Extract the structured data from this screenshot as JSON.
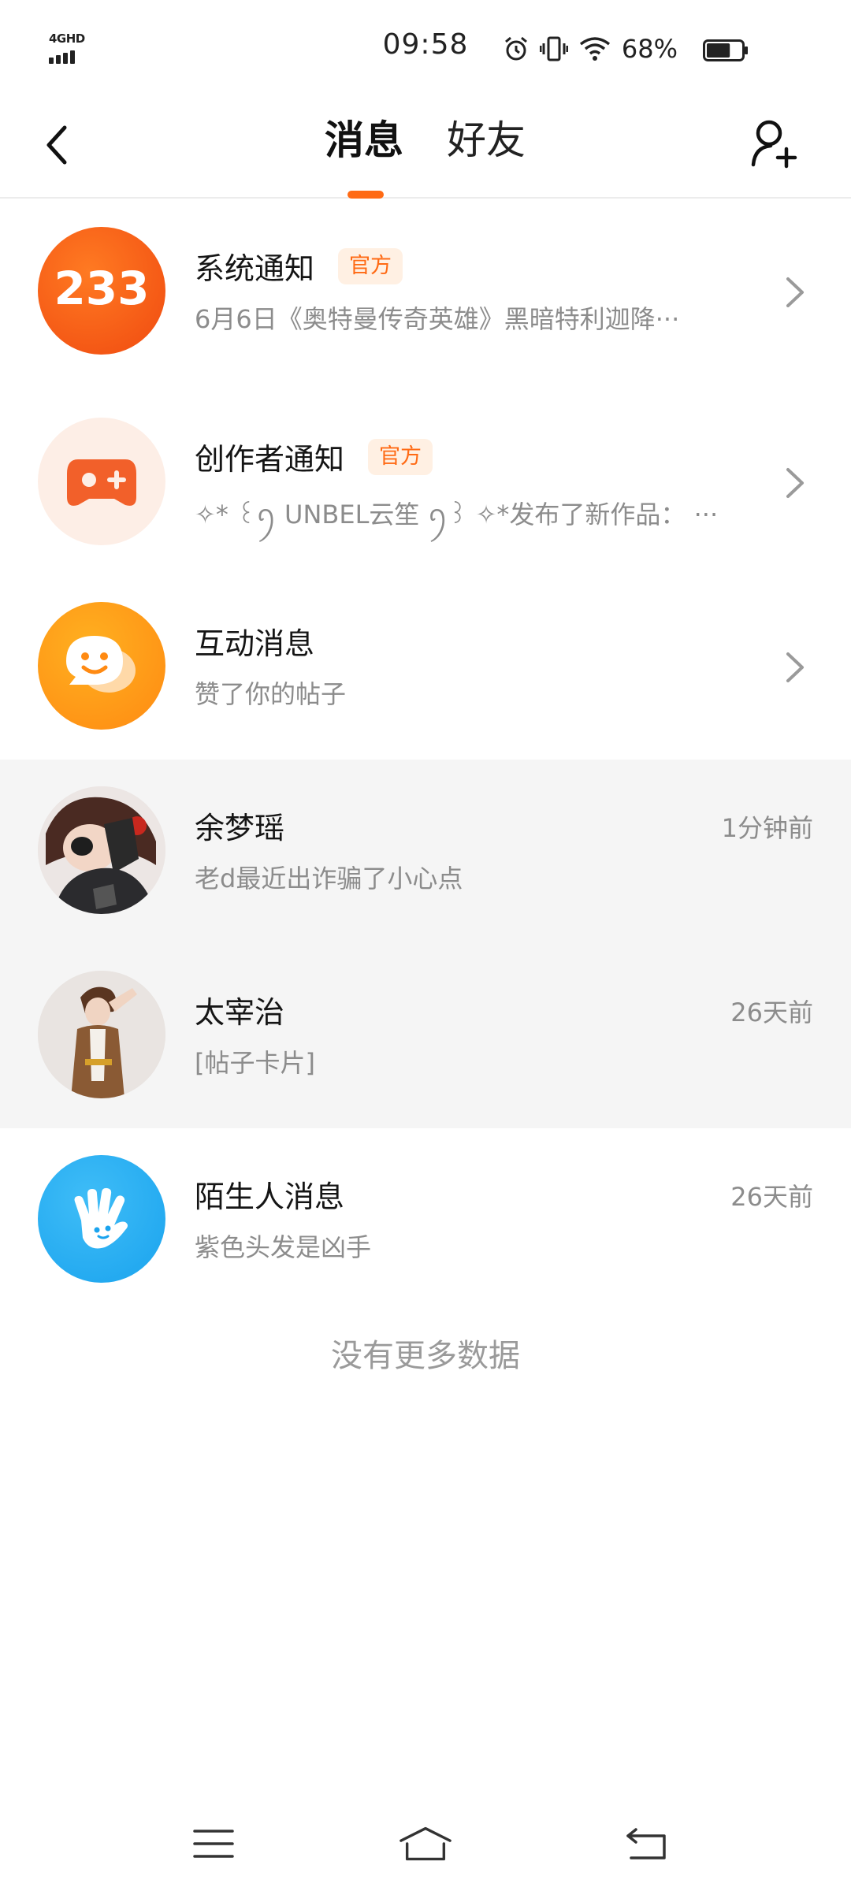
{
  "status_bar": {
    "network": "4GHD",
    "time": "09:58",
    "battery_percent": "68%",
    "battery_level": 0.68,
    "icons": [
      "alarm-icon",
      "vibrate-icon",
      "wifi-icon",
      "battery-icon"
    ]
  },
  "header": {
    "tabs": [
      {
        "label": "消息",
        "active": true
      },
      {
        "label": "好友",
        "active": false
      }
    ],
    "accent_color": "#ff6a14",
    "icons": [
      "back-arrow-icon",
      "add-friend-icon"
    ]
  },
  "conversations": [
    {
      "name": "系统通知",
      "badge": "官方",
      "preview": "6月6日《奥特曼传奇英雄》黑暗特利迦降···",
      "avatar_text": "233",
      "avatar_icon": "app-logo-233",
      "trailing": "chevron"
    },
    {
      "name": "创作者通知",
      "badge": "官方",
      "preview": "✧* ꒰ꪆ UNBEL云笙 ꪆ꒱ ✧*发布了新作品：   ···",
      "avatar_icon": "gamepad-icon",
      "trailing": "chevron"
    },
    {
      "name": "互动消息",
      "preview": "赞了你的帖子",
      "avatar_icon": "chat-bubble-smile-icon",
      "trailing": "chevron"
    },
    {
      "name": "余梦瑶",
      "preview": "老d最近出诈骗了小心点",
      "time": "1分钟前",
      "avatar_icon": "user-avatar-photo"
    },
    {
      "name": "太宰治",
      "preview": "[帖子卡片]",
      "time": "26天前",
      "avatar_icon": "user-avatar-photo"
    },
    {
      "name": "陌生人消息",
      "preview": "紫色头发是凶手",
      "time": "26天前",
      "avatar_icon": "waving-hand-icon"
    }
  ],
  "footer": {
    "no_more": "没有更多数据"
  },
  "nav_bar": {
    "icons": [
      "menu-icon",
      "home-icon",
      "back-icon"
    ]
  }
}
